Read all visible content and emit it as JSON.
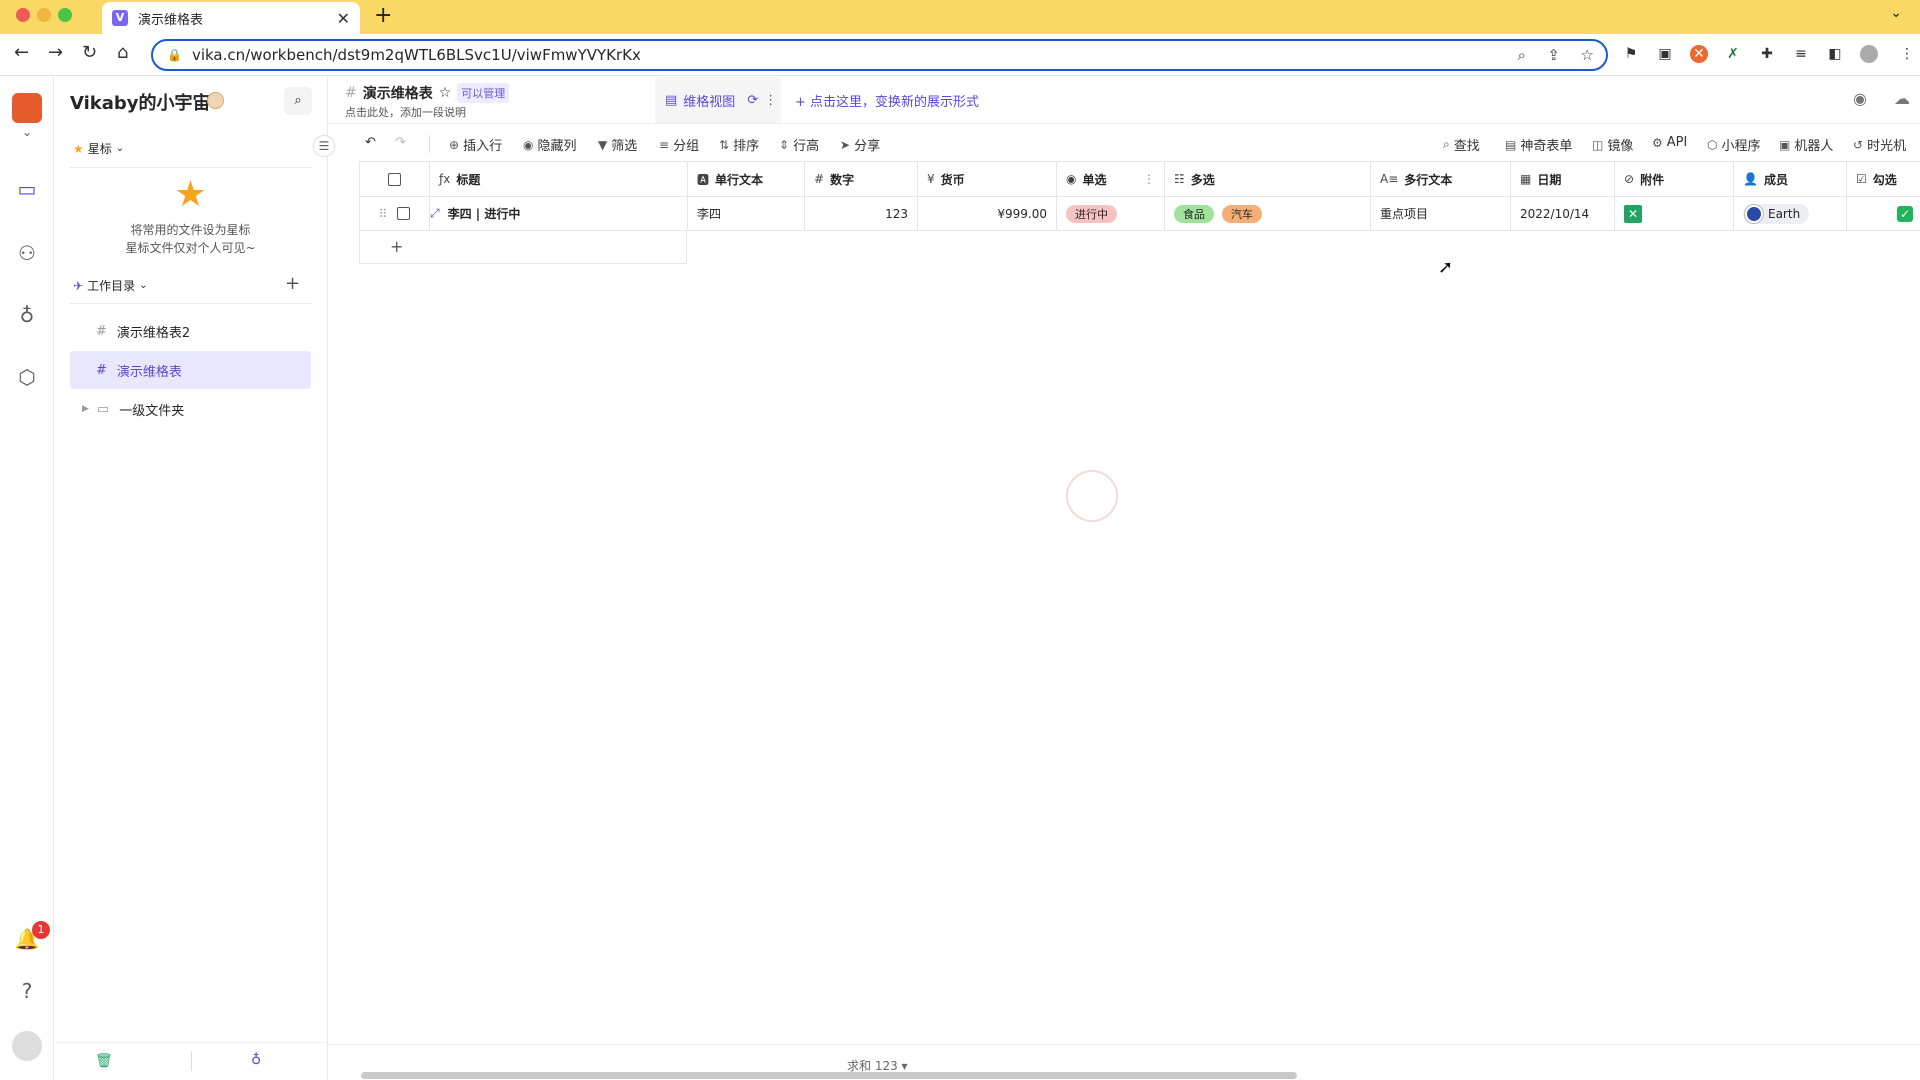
{
  "browser": {
    "tab_title": "演示维格表",
    "url": "vika.cn/workbench/dst9m2qWTL6BLSvc1U/viwFmwYVYKrKx"
  },
  "rail": {
    "notification_count": "1"
  },
  "sidebar": {
    "space_name": "Vikaby的小宇宙",
    "starred_label": "星标",
    "starred_empty_line1": "将常用的文件设为星标",
    "starred_empty_line2": "星标文件仅对个人可见~",
    "workdir_label": "工作目录",
    "nodes": [
      {
        "label": "演示维格表2"
      },
      {
        "label": "演示维格表"
      },
      {
        "label": "一级文件夹"
      }
    ]
  },
  "datasheet": {
    "title": "演示维格表",
    "permission": "可以管理",
    "description": "点击此处，添加一段说明",
    "view_name": "维格视图",
    "add_view_hint": "点击这里，变换新的展示形式"
  },
  "toolbar": {
    "insert_row": "插入行",
    "hide_fields": "隐藏列",
    "filter": "筛选",
    "group": "分组",
    "sort": "排序",
    "row_height": "行高",
    "share": "分享",
    "find": "查找",
    "form": "神奇表单",
    "mirror": "镜像",
    "api": "API",
    "widget": "小程序",
    "robot": "机器人",
    "time_machine": "时光机"
  },
  "grid": {
    "columns": [
      "标题",
      "单行文本",
      "数字",
      "货币",
      "单选",
      "多选",
      "多行文本",
      "日期",
      "附件",
      "成员",
      "勾选"
    ],
    "row": {
      "title": "李四 | 进行中",
      "text": "李四",
      "number": "123",
      "currency": "¥999.00",
      "single_select": "进行中",
      "multi_select": [
        "食品",
        "汽车"
      ],
      "long_text": "重点项目",
      "date": "2022/10/14",
      "member": "Earth"
    },
    "add_row": "+"
  },
  "status": {
    "sum": "求和 123 ▾"
  },
  "colors": {
    "accent": "#5b47d6",
    "tag_in_progress": "#f8c2c2",
    "tag_food": "#9fe39b",
    "tag_car": "#f6ae74"
  }
}
